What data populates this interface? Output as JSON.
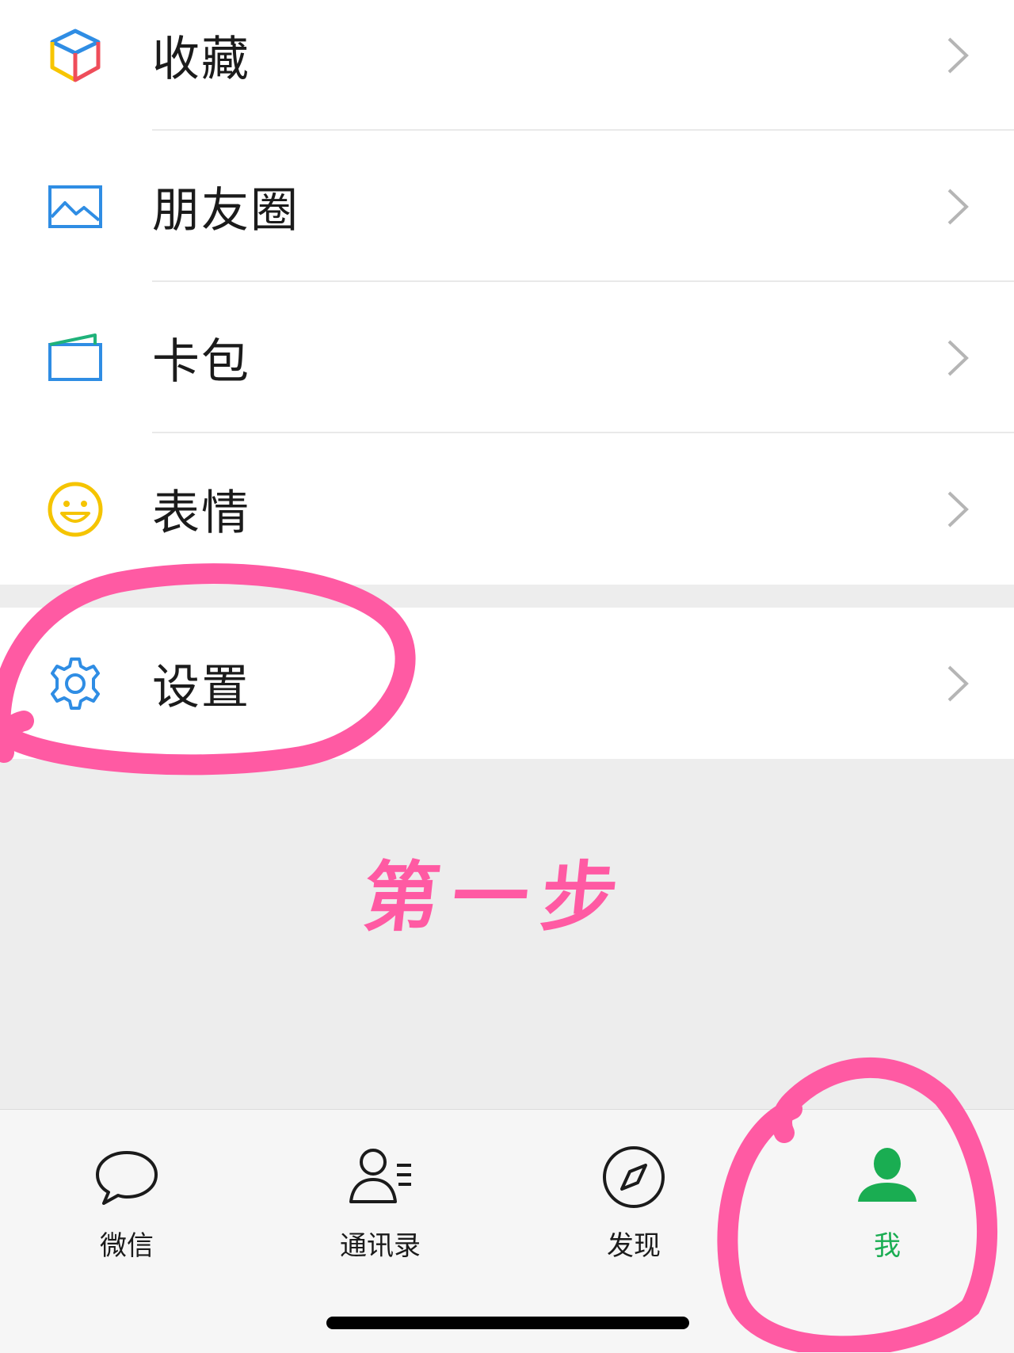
{
  "menu_group_1": [
    {
      "label": "收藏",
      "icon": "favorites-cube-icon"
    },
    {
      "label": "朋友圈",
      "icon": "moments-picture-icon"
    },
    {
      "label": "卡包",
      "icon": "card-wallet-icon"
    },
    {
      "label": "表情",
      "icon": "sticker-smiley-icon"
    }
  ],
  "menu_group_2": [
    {
      "label": "设置",
      "icon": "settings-gear-icon"
    }
  ],
  "annotation": {
    "text": "第一步",
    "color": "#ff5aa3"
  },
  "tabbar": {
    "tabs": [
      {
        "label": "微信",
        "icon": "chat-bubble-icon"
      },
      {
        "label": "通讯录",
        "icon": "contacts-icon"
      },
      {
        "label": "发现",
        "icon": "compass-icon"
      },
      {
        "label": "我",
        "icon": "profile-person-icon",
        "active": true
      }
    ],
    "active_color": "#1aad52"
  }
}
